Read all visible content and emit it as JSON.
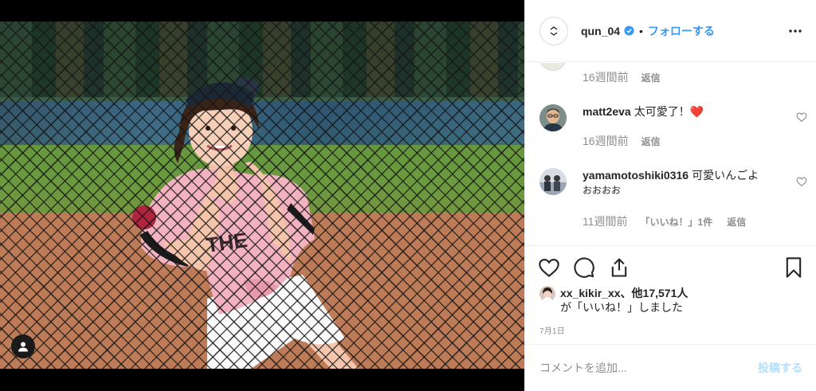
{
  "post": {
    "username": "qun_04",
    "dot": "•",
    "follow_label": "フォローする",
    "verified": true
  },
  "comments": [
    {
      "time": "16週間前",
      "reply": "返信"
    },
    {
      "user": "matt2eva",
      "text": "太可愛了！",
      "emoji": "❤️",
      "time": "16週間前",
      "reply": "返信"
    },
    {
      "user": "yamamotoshiki0316",
      "text": "可愛いんごよ",
      "text2": "おおおお",
      "time": "11週間前",
      "likes": "「いいね！」1件",
      "reply": "返信"
    }
  ],
  "likes": {
    "user": "xx_kikir_xx",
    "others": "、他17,571人",
    "suffix": "が「いいね！」しました"
  },
  "date": "7月1日",
  "comment_box": {
    "placeholder": "コメントを追加...",
    "post_label": "投稿する"
  },
  "colors": {
    "accent": "#3897f0",
    "post_disabled": "#b2dffc",
    "heart_red": "#ed4956",
    "muted": "#8e8e8e"
  },
  "icons": [
    "user-tag-icon",
    "verified-badge-icon",
    "more-options-icon",
    "heart-icon",
    "comment-icon",
    "share-icon",
    "save-icon"
  ]
}
